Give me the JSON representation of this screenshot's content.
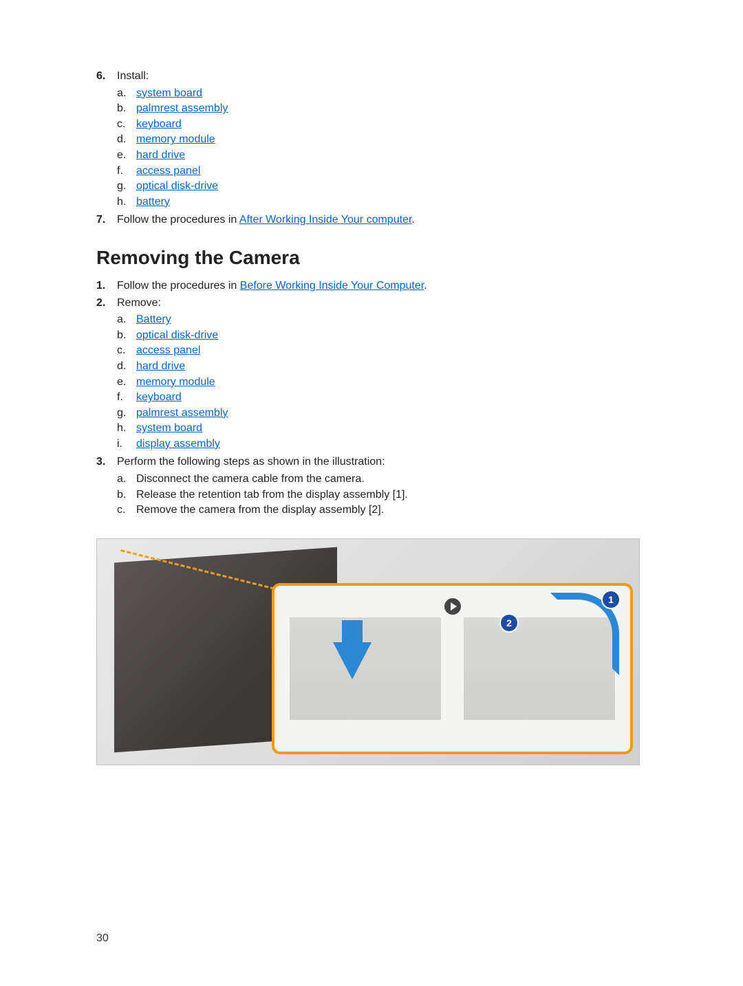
{
  "step6": {
    "number": "6.",
    "text": "Install:",
    "items": [
      {
        "letter": "a.",
        "label": "system board",
        "link": true
      },
      {
        "letter": "b.",
        "label": "palmrest assembly",
        "link": true
      },
      {
        "letter": "c.",
        "label": "keyboard",
        "link": true
      },
      {
        "letter": "d.",
        "label": "memory module",
        "link": true
      },
      {
        "letter": "e.",
        "label": "hard drive",
        "link": true
      },
      {
        "letter": "f.",
        "label": "access panel",
        "link": true
      },
      {
        "letter": "g.",
        "label": "optical disk-drive",
        "link": true
      },
      {
        "letter": "h.",
        "label": "battery",
        "link": true
      }
    ]
  },
  "step7": {
    "number": "7.",
    "prefix": "Follow the procedures in ",
    "link": "After Working Inside Your computer",
    "suffix": "."
  },
  "heading": "Removing the Camera",
  "rstep1": {
    "number": "1.",
    "prefix": "Follow the procedures in ",
    "link": "Before Working Inside Your Computer",
    "suffix": "."
  },
  "rstep2": {
    "number": "2.",
    "text": "Remove:",
    "items": [
      {
        "letter": "a.",
        "label": "Battery",
        "link": true
      },
      {
        "letter": "b.",
        "label": "optical disk-drive",
        "link": true
      },
      {
        "letter": "c.",
        "label": "access panel",
        "link": true
      },
      {
        "letter": "d.",
        "label": "hard drive",
        "link": true
      },
      {
        "letter": "e.",
        "label": "memory module",
        "link": true
      },
      {
        "letter": "f.",
        "label": "keyboard",
        "link": true
      },
      {
        "letter": "g.",
        "label": "palmrest assembly",
        "link": true
      },
      {
        "letter": "h.",
        "label": "system board",
        "link": true
      },
      {
        "letter": "i.",
        "label": "display assembly",
        "link": true
      }
    ]
  },
  "rstep3": {
    "number": "3.",
    "text": "Perform the following steps as shown in the illustration:",
    "items": [
      {
        "letter": "a.",
        "label": "Disconnect the camera cable from the camera.",
        "link": false
      },
      {
        "letter": "b.",
        "label": "Release the retention tab from the display assembly [1].",
        "link": false
      },
      {
        "letter": "c.",
        "label": "Remove the camera from the display assembly [2].",
        "link": false
      }
    ]
  },
  "figure": {
    "badge1": "1",
    "badge2": "2"
  },
  "page_number": "30"
}
